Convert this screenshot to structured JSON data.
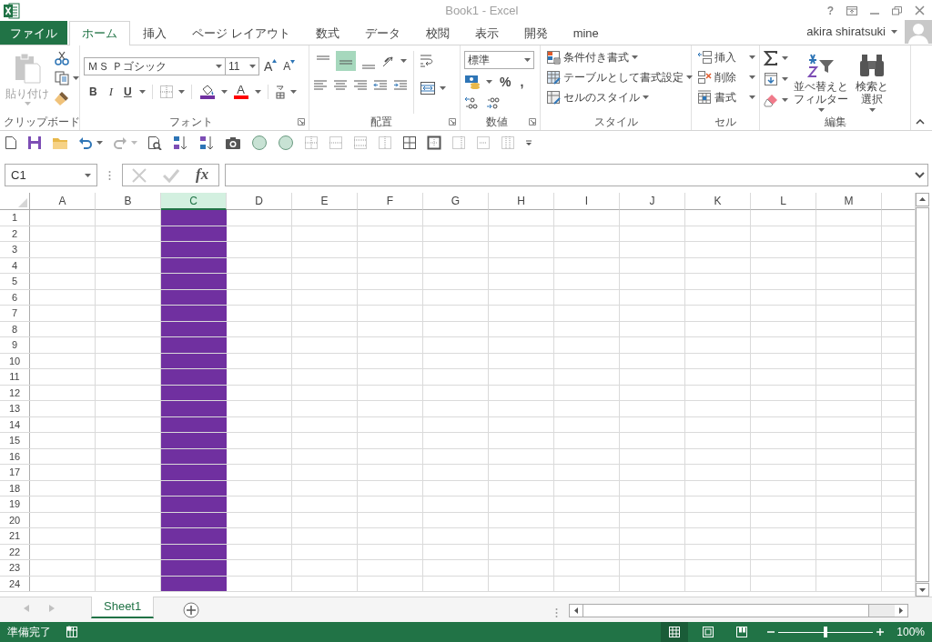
{
  "window": {
    "title": "Book1 - Excel",
    "help": "?"
  },
  "tabs": [
    {
      "label": "ファイル",
      "kind": "file",
      "selected": false
    },
    {
      "label": "ホーム",
      "kind": "tab",
      "selected": true
    },
    {
      "label": "挿入",
      "kind": "tab",
      "selected": false
    },
    {
      "label": "ページ レイアウト",
      "kind": "tab",
      "selected": false
    },
    {
      "label": "数式",
      "kind": "tab",
      "selected": false
    },
    {
      "label": "データ",
      "kind": "tab",
      "selected": false
    },
    {
      "label": "校閲",
      "kind": "tab",
      "selected": false
    },
    {
      "label": "表示",
      "kind": "tab",
      "selected": false
    },
    {
      "label": "開発",
      "kind": "tab",
      "selected": false
    },
    {
      "label": "mine",
      "kind": "tab",
      "selected": false
    }
  ],
  "account": {
    "name": "akira shiratsuki"
  },
  "ribbon": [
    {
      "kind": "clipboard",
      "label": "クリップボード",
      "paste": {
        "label": "貼り付け",
        "disabled": true
      }
    },
    {
      "kind": "font",
      "label": "フォント",
      "font_name": "ＭＳ Ｐゴシック",
      "font_size": "11",
      "grow": "A",
      "shrink": "A",
      "bold": "B",
      "italic": "I",
      "underline": "U",
      "fill": {
        "color": "#7030a0"
      },
      "font_color": {
        "letter": "A",
        "color": "#ff0000"
      }
    },
    {
      "kind": "alignment",
      "label": "配置",
      "vertical": [
        {
          "selected": false
        },
        {
          "selected": true
        },
        {
          "selected": false
        }
      ]
    },
    {
      "kind": "number",
      "label": "数値",
      "format": "標準",
      "percent": "%",
      "comma": ","
    },
    {
      "kind": "styles",
      "label": "スタイル",
      "items": [
        "条件付き書式",
        "テーブルとして書式設定",
        "セルのスタイル"
      ]
    },
    {
      "kind": "cells",
      "label": "セル",
      "items": [
        "挿入",
        "削除",
        "書式"
      ]
    },
    {
      "kind": "editing",
      "label": "編集",
      "sort_lines": [
        "並べ替えと",
        "フィルター"
      ],
      "find_lines": [
        "検索と",
        "選択"
      ]
    }
  ],
  "quick_access": {
    "redo": {
      "disabled": true
    }
  },
  "formula_bar": {
    "name_box": "C1",
    "fx": "fx"
  },
  "sheet": {
    "columns": [
      {
        "label": "A",
        "selected": false
      },
      {
        "label": "B",
        "selected": false
      },
      {
        "label": "C",
        "selected": true,
        "color": "#7030a0"
      },
      {
        "label": "D",
        "selected": false
      },
      {
        "label": "E",
        "selected": false
      },
      {
        "label": "F",
        "selected": false
      },
      {
        "label": "G",
        "selected": false
      },
      {
        "label": "H",
        "selected": false
      },
      {
        "label": "I",
        "selected": false
      },
      {
        "label": "J",
        "selected": false
      },
      {
        "label": "K",
        "selected": false
      },
      {
        "label": "L",
        "selected": false
      },
      {
        "label": "M",
        "selected": false
      }
    ],
    "rows": [
      "1",
      "2",
      "3",
      "4",
      "5",
      "6",
      "7",
      "8",
      "9",
      "10",
      "11",
      "12",
      "13",
      "14",
      "15",
      "16",
      "17",
      "18",
      "19",
      "20",
      "21",
      "22",
      "23",
      "24"
    ]
  },
  "sheet_tabs": [
    {
      "label": "Sheet1",
      "selected": true
    }
  ],
  "status_bar": {
    "text": "準備完了",
    "views": [
      {
        "selected": true
      },
      {
        "selected": false
      },
      {
        "selected": false
      }
    ],
    "zoom": {
      "level": 0.5,
      "reading": "100%"
    }
  }
}
